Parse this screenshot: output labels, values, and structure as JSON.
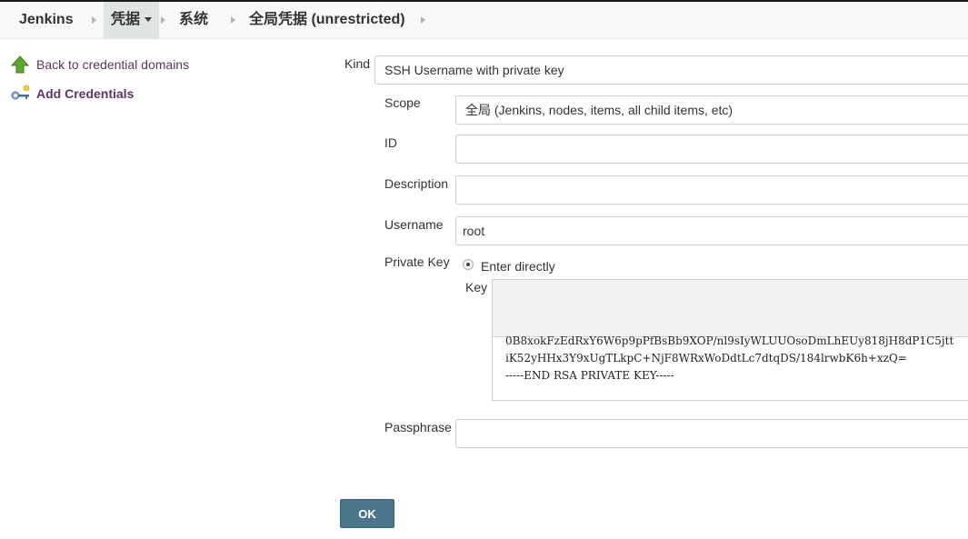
{
  "breadcrumb": {
    "items": [
      "Jenkins",
      "凭据",
      "系统",
      "全局凭据 (unrestricted)"
    ]
  },
  "sidebar": {
    "back_label": "Back to credential domains",
    "add_label": "Add Credentials"
  },
  "form": {
    "kind_label": "Kind",
    "kind_value": "SSH Username with private key",
    "scope_label": "Scope",
    "scope_value": "全局 (Jenkins, nodes, items, all child items, etc)",
    "id_label": "ID",
    "id_value": "",
    "description_label": "Description",
    "description_value": "",
    "username_label": "Username",
    "username_value": "root",
    "private_key_label": "Private Key",
    "private_key_option": "Enter directly",
    "key_label": "Key",
    "key_lines": [
      "0B8xokFzEdRxY6W6p9pPfBsBb9XOP/nl9sIyWLUUOsoDmLhEUy818jH8dP1C5jtt",
      "iK52yHHx3Y9xUgTLkpC+NjF8WRxWoDdtLc7dtqDS/184lrwbK6h+xzQ=",
      "-----END RSA PRIVATE KEY-----"
    ],
    "passphrase_label": "Passphrase",
    "passphrase_value": ""
  },
  "actions": {
    "ok_label": "OK"
  },
  "colors": {
    "link": "#5c3566",
    "button": "#4b758b",
    "breadcrumb_active": "#dfe3e3"
  }
}
